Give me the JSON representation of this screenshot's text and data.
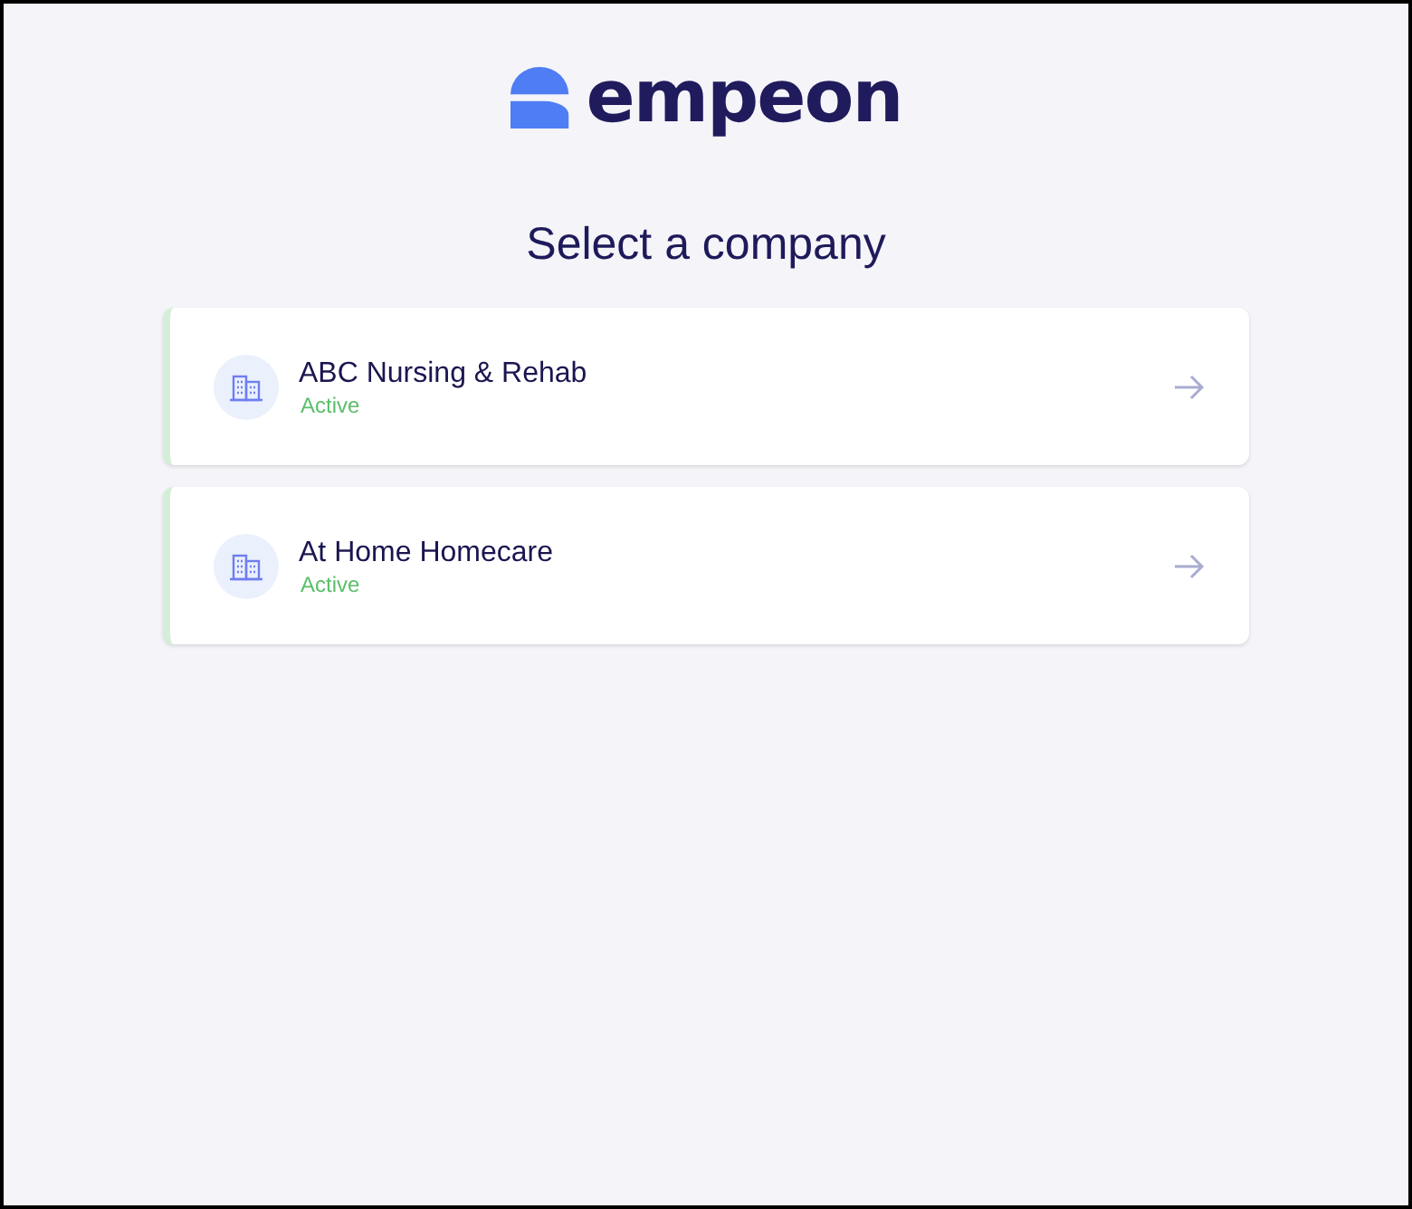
{
  "logo": {
    "text": "empeon"
  },
  "title": "Select a company",
  "companies": [
    {
      "name": "ABC Nursing & Rehab",
      "status": "Active"
    },
    {
      "name": "At Home Homecare",
      "status": "Active"
    }
  ]
}
